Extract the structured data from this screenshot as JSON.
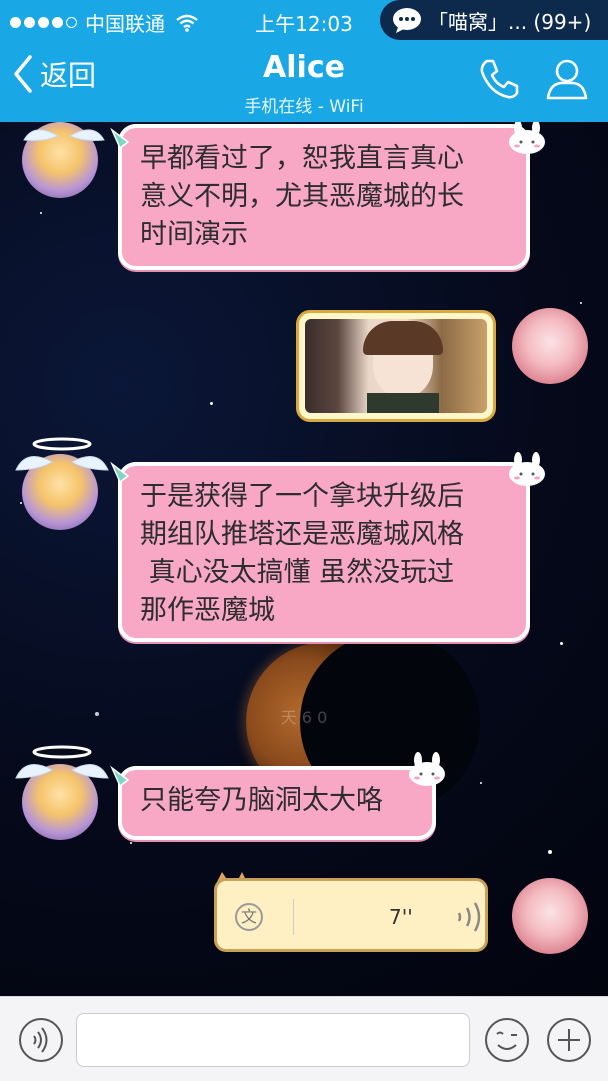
{
  "status_bar": {
    "carrier": "中国联通",
    "time": "上午12:03",
    "notification": "「喵窝」... (99+)"
  },
  "nav": {
    "back_label": "返回",
    "title": "Alice",
    "subtitle": "手机在线 - WiFi"
  },
  "chat": {
    "date_separator": "天 6 0",
    "messages": [
      {
        "sender": "Alice",
        "type": "text",
        "text": "早都看过了，恕我直言真心\n意义不明，尤其恶魔城的长\n时间演示"
      },
      {
        "sender": "me",
        "type": "image"
      },
      {
        "sender": "Alice",
        "type": "text",
        "text": "于是获得了一个拿块升级后\n期组队推塔还是恶魔城风格\n 真心没太搞懂 虽然没玩过\n那作恶魔城"
      },
      {
        "sender": "Alice",
        "type": "text",
        "text": "只能夸乃脑洞太大咯"
      },
      {
        "sender": "me",
        "type": "voice",
        "duration": "7''",
        "translate_label": "文"
      }
    ]
  },
  "colors": {
    "nav_bg": "#1aa7e6",
    "bubble_pink": "#f8a8c5",
    "voice_bubble": "#fff0c4"
  }
}
